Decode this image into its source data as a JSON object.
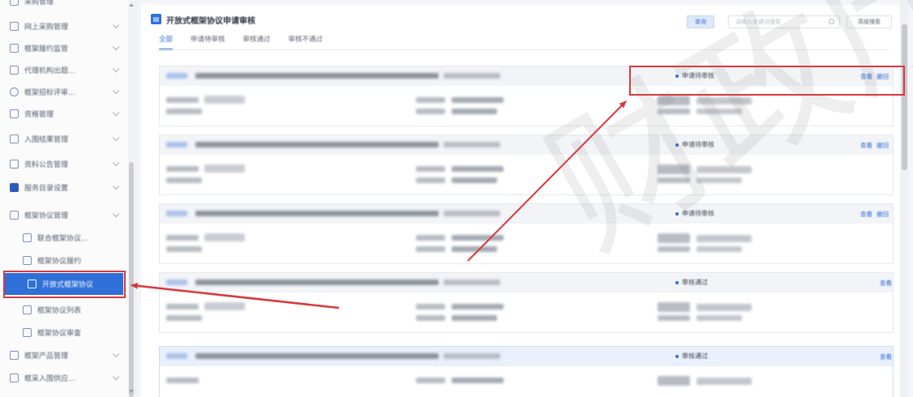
{
  "sidebar": {
    "items": [
      {
        "label": "采购管理",
        "icon": "list-icon"
      },
      {
        "label": "网上采购管理",
        "icon": "list-icon"
      },
      {
        "label": "框架履约监管",
        "icon": "list-icon"
      },
      {
        "label": "代理机构出题...",
        "icon": "list-icon"
      },
      {
        "label": "框架招标评审...",
        "icon": "person-icon"
      },
      {
        "label": "资格管理",
        "icon": "list-icon"
      },
      {
        "label": "入围结果管理",
        "icon": "list-icon"
      },
      {
        "label": "资料公告管理",
        "icon": "list-icon"
      },
      {
        "label": "服务目录设置",
        "icon": "grid-icon"
      },
      {
        "label": "框架协议管理",
        "icon": "list-icon"
      },
      {
        "label": "联合框架协议...",
        "icon": "list-icon"
      },
      {
        "label": "框架协议履约",
        "icon": "list-icon"
      },
      {
        "label": "开放式框架协议",
        "icon": "document-icon"
      },
      {
        "label": "框架协议列表",
        "icon": "list-icon"
      },
      {
        "label": "框架协议审查",
        "icon": "list-icon"
      },
      {
        "label": "框架产品管理",
        "icon": "list-icon"
      },
      {
        "label": "框采入围供应...",
        "icon": "list-icon"
      }
    ]
  },
  "page": {
    "title": "开放式框架协议申请审核",
    "tabs": [
      "全部",
      "申请待审核",
      "审核通过",
      "审核不通过"
    ],
    "query_label": "查询",
    "search_placeholder": "请输入关键词搜索",
    "advanced_label": "高级搜索"
  },
  "cards": [
    {
      "status": "申请待审核",
      "view_label": "查看",
      "withdraw_label": "撤回"
    },
    {
      "status": "申请待审核",
      "view_label": "查看",
      "withdraw_label": "撤回"
    },
    {
      "status": "申请待审核",
      "view_label": "查看",
      "withdraw_label": "撤回"
    },
    {
      "status": "审核通过",
      "view_label": "查看"
    },
    {
      "status": "审核通过",
      "view_label": "查看"
    }
  ],
  "watermark": "财政厅",
  "colors": {
    "accent": "#2e6fd8",
    "annotation": "#d9383a"
  }
}
